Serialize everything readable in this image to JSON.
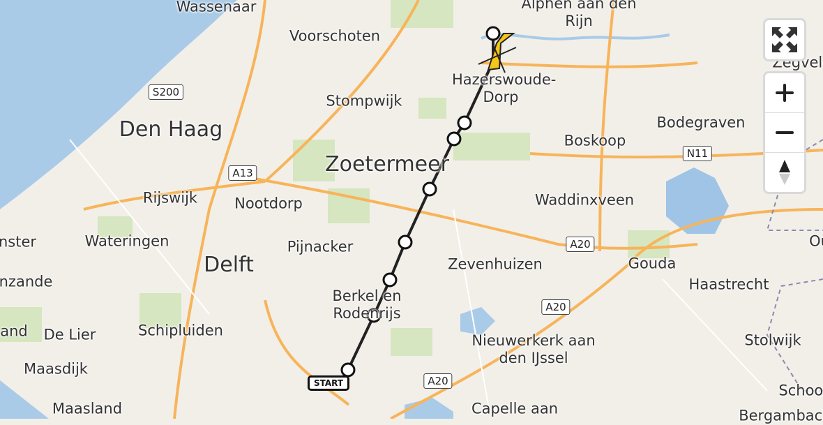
{
  "map": {
    "places": [
      {
        "name": "Wassenaar",
        "cls": ""
      },
      {
        "name": "Voorschoten",
        "cls": ""
      },
      {
        "name": "Alphen aan den Rijn",
        "cls": ""
      },
      {
        "name": "Zegveld",
        "cls": ""
      },
      {
        "name": "Hazerswoude-Dorp",
        "cls": ""
      },
      {
        "name": "Stompwijk",
        "cls": ""
      },
      {
        "name": "Den Haag",
        "cls": "big"
      },
      {
        "name": "Zoetermeer",
        "cls": "big"
      },
      {
        "name": "Bodegraven",
        "cls": ""
      },
      {
        "name": "Boskoop",
        "cls": ""
      },
      {
        "name": "Rijswijk",
        "cls": ""
      },
      {
        "name": "Nootdorp",
        "cls": ""
      },
      {
        "name": "Waddinxveen",
        "cls": ""
      },
      {
        "name": "Wateringen",
        "cls": ""
      },
      {
        "name": "Delft",
        "cls": "big"
      },
      {
        "name": "Pijnacker",
        "cls": ""
      },
      {
        "name": "Zevenhuizen",
        "cls": ""
      },
      {
        "name": "Gouda",
        "cls": ""
      },
      {
        "name": "Berkel en Rodenrijs",
        "cls": ""
      },
      {
        "name": "Haastrecht",
        "cls": ""
      },
      {
        "name": "Schipluiden",
        "cls": ""
      },
      {
        "name": "De Lier",
        "cls": ""
      },
      {
        "name": "Nieuwerkerk aan den IJssel",
        "cls": ""
      },
      {
        "name": "Stolwijk",
        "cls": ""
      },
      {
        "name": "Maasdijk",
        "cls": ""
      },
      {
        "name": "Maasland",
        "cls": ""
      },
      {
        "name": "Capelle aan",
        "cls": ""
      },
      {
        "name": "Schoon",
        "cls": ""
      },
      {
        "name": "Bergambacht",
        "cls": ""
      },
      {
        "name": "Ou",
        "cls": ""
      },
      {
        "name": "nster",
        "cls": ""
      },
      {
        "name": "nzande",
        "cls": ""
      },
      {
        "name": "and",
        "cls": ""
      }
    ],
    "road_shields": [
      "S200",
      "A13",
      "A20",
      "A20",
      "A20",
      "N11"
    ],
    "route": {
      "color": "#222222",
      "marker_start_label": "START",
      "end_marker_color": "#f5c518"
    },
    "colors": {
      "land": "#f2efe9",
      "water": "#a9cbe8",
      "road": "#f7b45a",
      "green": "#cfe3b8"
    }
  },
  "controls": {
    "fullscreen_icon": "fullscreen-icon",
    "zoom_in_icon": "plus-icon",
    "zoom_out_icon": "minus-icon",
    "compass_icon": "compass-icon"
  }
}
